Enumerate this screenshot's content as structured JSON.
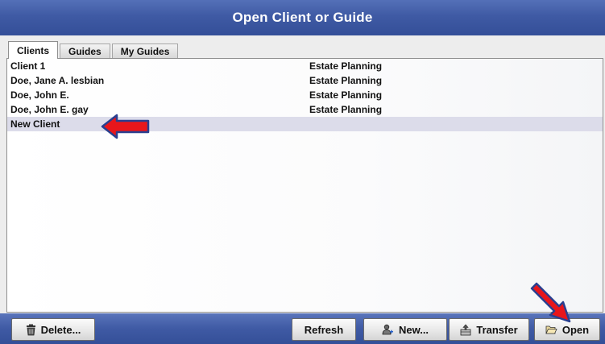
{
  "window": {
    "title": "Open Client or Guide"
  },
  "tabs": [
    {
      "label": "Clients",
      "active": true
    },
    {
      "label": "Guides",
      "active": false
    },
    {
      "label": "My Guides",
      "active": false
    }
  ],
  "clients": [
    {
      "name": "Client 1",
      "type": "Estate Planning",
      "selected": false
    },
    {
      "name": "Doe, Jane A. lesbian",
      "type": "Estate Planning",
      "selected": false
    },
    {
      "name": "Doe, John E.",
      "type": "Estate Planning",
      "selected": false
    },
    {
      "name": "Doe, John E. gay",
      "type": "Estate Planning",
      "selected": false
    },
    {
      "name": "New Client",
      "type": "",
      "selected": true
    }
  ],
  "buttons": {
    "delete": "Delete...",
    "refresh": "Refresh",
    "new": "New...",
    "transfer": "Transfer",
    "open": "Open"
  },
  "icons": {
    "delete": "trash-icon",
    "new": "person-add-icon",
    "transfer": "transfer-icon",
    "open": "open-folder-icon",
    "annotation": "red-arrow-icon"
  },
  "colors": {
    "title_bar": "#3f5aa4",
    "selected_row": "#dcdcea",
    "annotation_arrow": "#e8161b",
    "annotation_outline": "#2a3f8f"
  }
}
